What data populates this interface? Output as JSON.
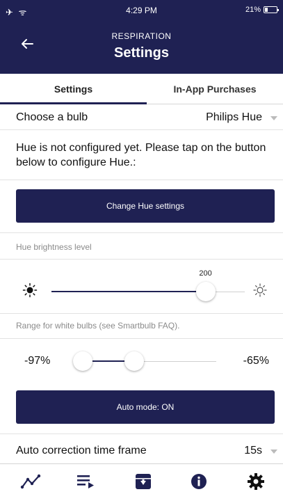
{
  "status_bar": {
    "left_icons": "✈ ᯤ",
    "time": "4:29 PM",
    "battery": "21%"
  },
  "header": {
    "subtitle": "RESPIRATION",
    "title": "Settings"
  },
  "tabs": [
    {
      "label": "Settings",
      "active": true
    },
    {
      "label": "In-App Purchases",
      "active": false
    }
  ],
  "bulb": {
    "label": "Choose a bulb",
    "value": "Philips Hue"
  },
  "hue_info": "Hue is not configured yet. Please tap on the button below to configure Hue.:",
  "change_hue_button": "Change Hue settings",
  "brightness": {
    "label": "Hue brightness level",
    "value": "200",
    "fraction": 0.8
  },
  "white_range": {
    "label": "Range for white bulbs (see Smartbulb FAQ).",
    "min_text": "-97%",
    "max_text": "-65%",
    "low_fraction": 0.0,
    "high_fraction": 0.36
  },
  "auto_mode_button": "Auto mode: ON",
  "auto_correction": {
    "label": "Auto correction time frame",
    "value": "15s"
  },
  "bottom_nav": [
    {
      "icon": "chart-line-icon"
    },
    {
      "icon": "playlist-icon"
    },
    {
      "icon": "archive-icon"
    },
    {
      "icon": "info-icon"
    },
    {
      "icon": "gear-icon"
    }
  ],
  "colors": {
    "primary": "#1f2153",
    "divider": "#e2e2e2",
    "muted_text": "#8a8a8a"
  }
}
